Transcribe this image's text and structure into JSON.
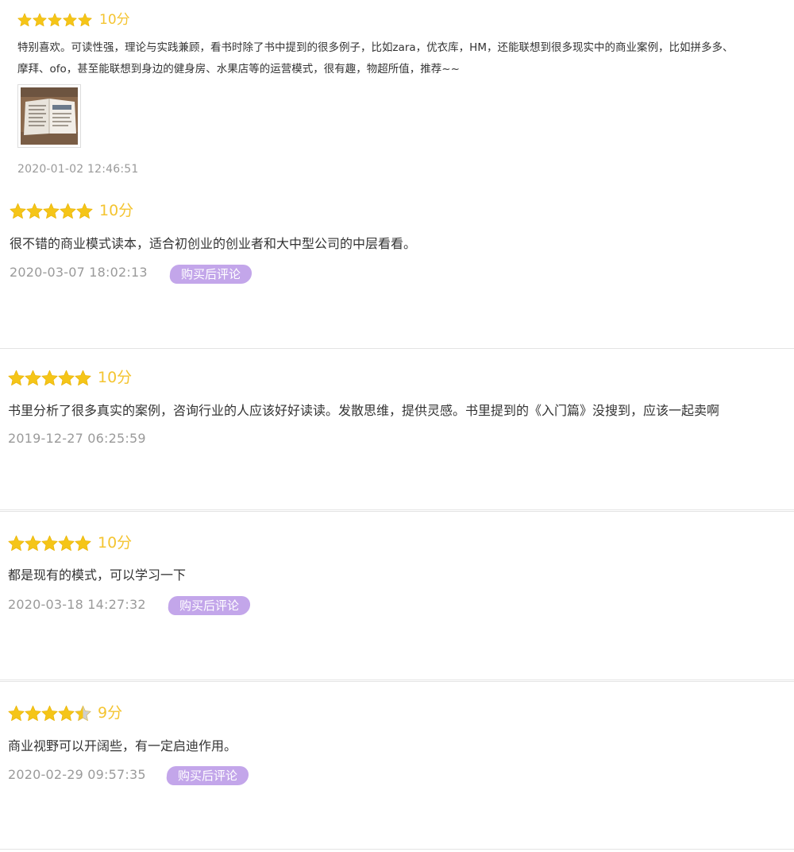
{
  "reviews": [
    {
      "score": "10分",
      "stars": 5,
      "text_lines": [
        "特别喜欢。可读性强，理论与实践兼顾，看书时除了书中提到的很多例子，比如zara，优衣库，HM，还能联想到很多现实中的商业案例，比如拼多多、",
        "摩拜、ofo，甚至能联想到身边的健身房、水果店等的运营模式，很有趣，物超所值，推荐~~"
      ],
      "has_image": true,
      "date": "2020-01-02 12:46:51"
    },
    {
      "score": "10分",
      "stars": 5,
      "text": "很不错的商业模式读本，适合初创业的创业者和大中型公司的中层看看。",
      "date": "2020-03-07 18:02:13",
      "badge": "购买后评论"
    },
    {
      "score": "10分",
      "stars": 5,
      "text": "书里分析了很多真实的案例，咨询行业的人应该好好读读。发散思维，提供灵感。书里提到的《入门篇》没搜到，应该一起卖啊",
      "date": "2019-12-27 06:25:59"
    },
    {
      "score": "10分",
      "stars": 5,
      "text": "都是现有的模式，可以学习一下",
      "date": "2020-03-18 14:27:32",
      "badge": "购买后评论"
    },
    {
      "score": "9分",
      "stars": 4.5,
      "text": "商业视野可以开阔些，有一定启迪作用。",
      "date": "2020-02-29 09:57:35",
      "badge": "购买后评论"
    }
  ],
  "icons": {
    "star": "star-icon",
    "half_star": "half-star-icon",
    "photo": "book-photo-thumbnail"
  },
  "colors": {
    "star_gold": "#f5c518",
    "star_gray": "#cfcfcf",
    "score_text": "#f4c430",
    "badge_bg": "#c3a6ea",
    "date_text": "#9a9a9a",
    "body_text": "#333333"
  }
}
